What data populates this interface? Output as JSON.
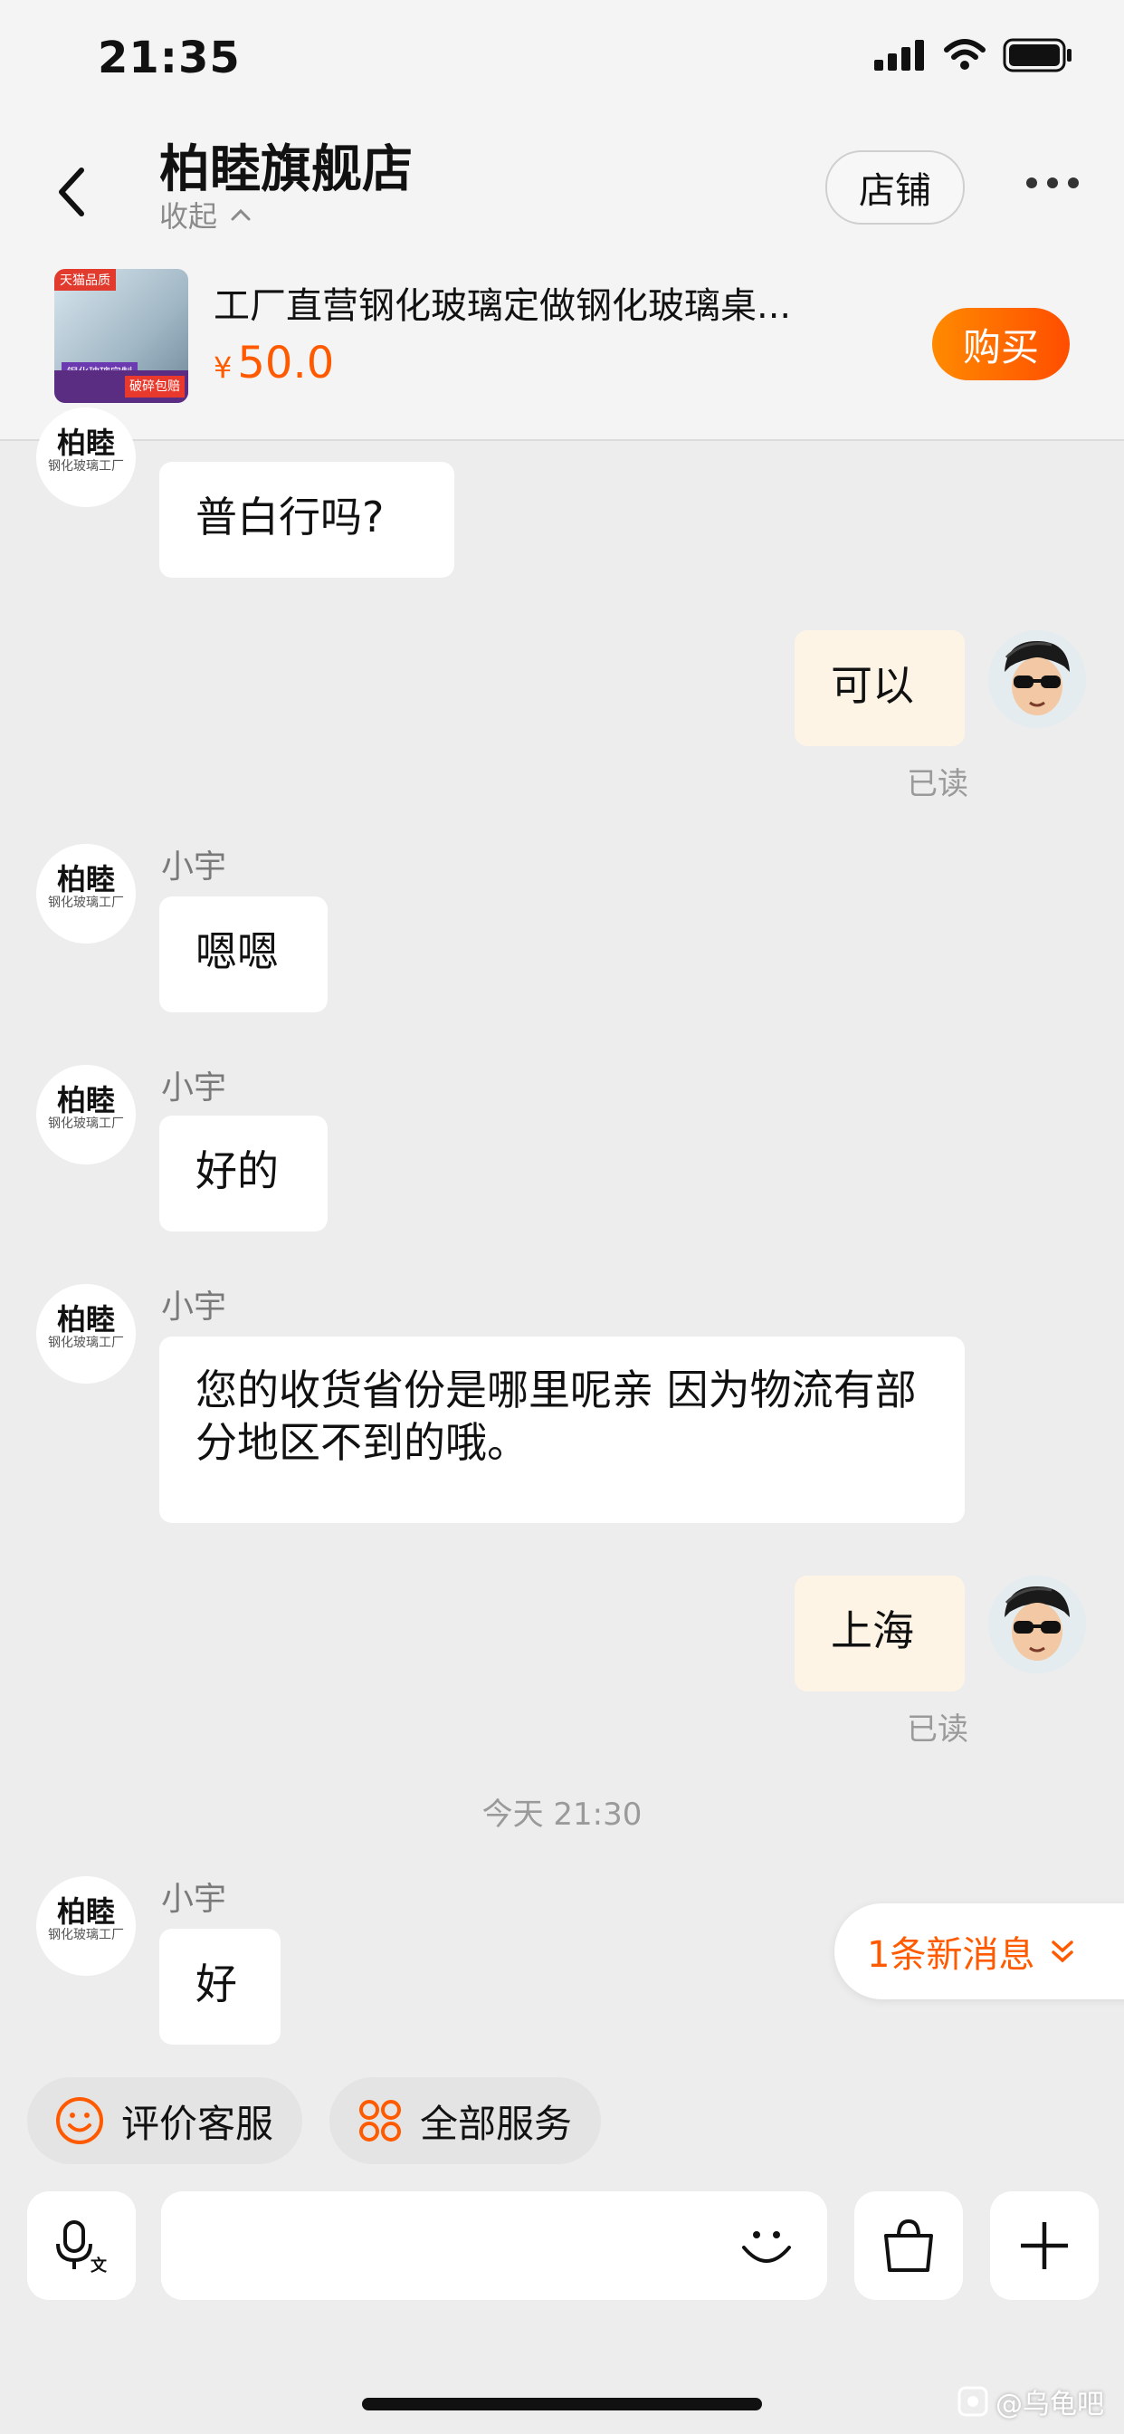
{
  "status_bar": {
    "time": "21:35"
  },
  "header": {
    "shop_name": "柏睦旗舰店",
    "collapse_label": "收起",
    "store_button": "店铺"
  },
  "product": {
    "title": "工厂直营钢化玻璃定做钢化玻璃桌...",
    "currency": "¥",
    "price": "50.0",
    "buy_label": "购买",
    "thumb_text": {
      "brand": "天猫品质",
      "service": "钢化玻璃定制",
      "badge": "破碎包赔"
    }
  },
  "store_avatar": {
    "line1": "柏睦",
    "line2": "钢化玻璃工厂"
  },
  "messages": [
    {
      "side": "left",
      "sender": "",
      "text": "普白行吗?"
    },
    {
      "side": "right",
      "text": "可以",
      "status": "已读"
    },
    {
      "side": "left",
      "sender": "小宇",
      "text": "嗯嗯"
    },
    {
      "side": "left",
      "sender": "小宇",
      "text": "好的"
    },
    {
      "side": "left",
      "sender": "小宇",
      "text": "您的收货省份是哪里呢亲 因为物流有部分地区不到的哦。"
    },
    {
      "side": "right",
      "text": "上海",
      "status": "已读"
    },
    {
      "type": "timestamp",
      "text": "今天 21:30"
    },
    {
      "side": "left",
      "sender": "小宇",
      "text": "好"
    }
  ],
  "new_message_pill": "1条新消息",
  "quick_actions": [
    {
      "label": "评价客服",
      "icon": "smiley-icon"
    },
    {
      "label": "全部服务",
      "icon": "grid-icon"
    }
  ],
  "input": {
    "placeholder": "",
    "value": ""
  },
  "watermark": "@乌龟吧",
  "colors": {
    "accent": "#ff5a00",
    "background": "#ededed",
    "my_bubble": "#fdf4e6"
  }
}
